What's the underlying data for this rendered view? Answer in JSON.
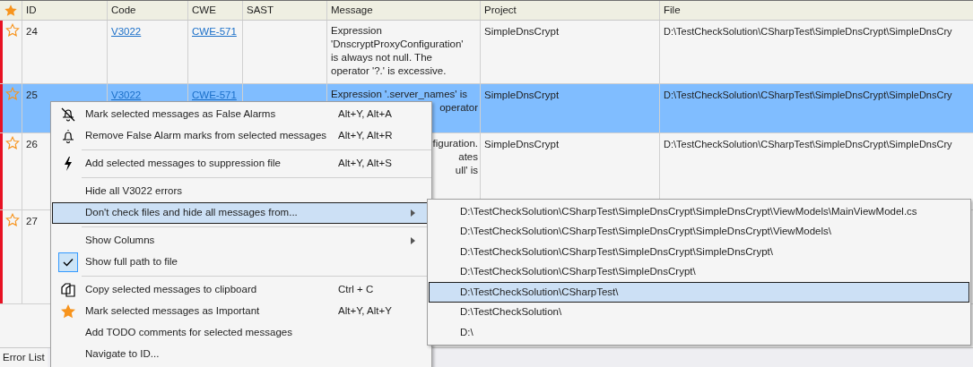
{
  "table": {
    "columns": [
      "ID",
      "Code",
      "CWE",
      "SAST",
      "Message",
      "Project",
      "File"
    ],
    "rows": [
      {
        "id": "24",
        "code": "V3022",
        "cwe": "CWE-571",
        "message": [
          {
            "text": "Expression",
            "kind": "line"
          },
          {
            "text": "'DnscryptProxyConfiguration'",
            "kind": "line"
          },
          {
            "text": "is always not null. The",
            "kind": "line"
          },
          {
            "text": "operator '?.' is excessive.",
            "kind": "line"
          }
        ],
        "project": "SimpleDnsCrypt",
        "file": "D:\\TestCheckSolution\\CSharpTest\\SimpleDnsCrypt\\SimpleDnsCry",
        "selected": false,
        "important": false
      },
      {
        "id": "25",
        "code": "V3022",
        "cwe": "CWE-571",
        "message": [
          {
            "text": "Expression '.server_names' is",
            "kind": "line"
          },
          {
            "text": "operator",
            "kind": "fragment"
          }
        ],
        "project": "SimpleDnsCrypt",
        "file": "D:\\TestCheckSolution\\CSharpTest\\SimpleDnsCrypt\\SimpleDnsCry",
        "selected": true,
        "important": false
      },
      {
        "id": "26",
        "message": [
          {
            "text": "figuration.",
            "kind": "fragment"
          },
          {
            "text": "ates",
            "kind": "fragment"
          },
          {
            "text": "ull' is",
            "kind": "fragment"
          }
        ],
        "project": "SimpleDnsCrypt",
        "file": "D:\\TestCheckSolution\\CSharpTest\\SimpleDnsCrypt\\SimpleDnsCry",
        "selected": false,
        "important": false
      },
      {
        "id": "27",
        "selected": false,
        "important": false
      }
    ]
  },
  "context_menu": {
    "items": [
      {
        "kind": "item",
        "label": "Mark selected messages as False Alarms",
        "shortcut": "Alt+Y, Alt+A",
        "submenu": false,
        "selected": false,
        "checked": false
      },
      {
        "kind": "item",
        "label": "Remove False Alarm marks from selected messages",
        "shortcut": "Alt+Y, Alt+R",
        "submenu": false,
        "selected": false,
        "checked": false
      },
      {
        "kind": "separator"
      },
      {
        "kind": "item",
        "label": "Add selected messages to suppression file",
        "shortcut": "Alt+Y, Alt+S",
        "submenu": false,
        "selected": false,
        "checked": false
      },
      {
        "kind": "separator"
      },
      {
        "kind": "item",
        "label": "Hide all V3022 errors",
        "submenu": false,
        "selected": false,
        "checked": false
      },
      {
        "kind": "item",
        "label": "Don't check files and hide all messages from...",
        "submenu": true,
        "selected": true,
        "checked": false
      },
      {
        "kind": "separator"
      },
      {
        "kind": "item",
        "label": "Show Columns",
        "submenu": true,
        "selected": false,
        "checked": false
      },
      {
        "kind": "item",
        "label": "Show full path to file",
        "submenu": false,
        "selected": false,
        "checked": true
      },
      {
        "kind": "separator"
      },
      {
        "kind": "item",
        "label": "Copy selected messages to clipboard",
        "shortcut": "Ctrl + C",
        "submenu": false,
        "selected": false,
        "checked": false
      },
      {
        "kind": "item",
        "label": "Mark selected messages as Important",
        "shortcut": "Alt+Y, Alt+Y",
        "submenu": false,
        "selected": false,
        "checked": false
      },
      {
        "kind": "item",
        "label": "Add TODO comments for selected messages",
        "submenu": false,
        "selected": false,
        "checked": false
      },
      {
        "kind": "item",
        "label": "Navigate to ID...",
        "submenu": false,
        "selected": false,
        "checked": false
      }
    ]
  },
  "submenu": {
    "items": [
      {
        "label": "D:\\TestCheckSolution\\CSharpTest\\SimpleDnsCrypt\\SimpleDnsCrypt\\ViewModels\\MainViewModel.cs",
        "selected": false
      },
      {
        "label": "D:\\TestCheckSolution\\CSharpTest\\SimpleDnsCrypt\\SimpleDnsCrypt\\ViewModels\\",
        "selected": false
      },
      {
        "label": "D:\\TestCheckSolution\\CSharpTest\\SimpleDnsCrypt\\SimpleDnsCrypt\\",
        "selected": false
      },
      {
        "label": "D:\\TestCheckSolution\\CSharpTest\\SimpleDnsCrypt\\",
        "selected": false
      },
      {
        "label": "D:\\TestCheckSolution\\CSharpTest\\",
        "selected": true
      },
      {
        "label": "D:\\TestCheckSolution\\",
        "selected": false
      },
      {
        "label": "D:\\",
        "selected": false
      }
    ]
  },
  "bottom_tabs": [
    "Error List"
  ]
}
